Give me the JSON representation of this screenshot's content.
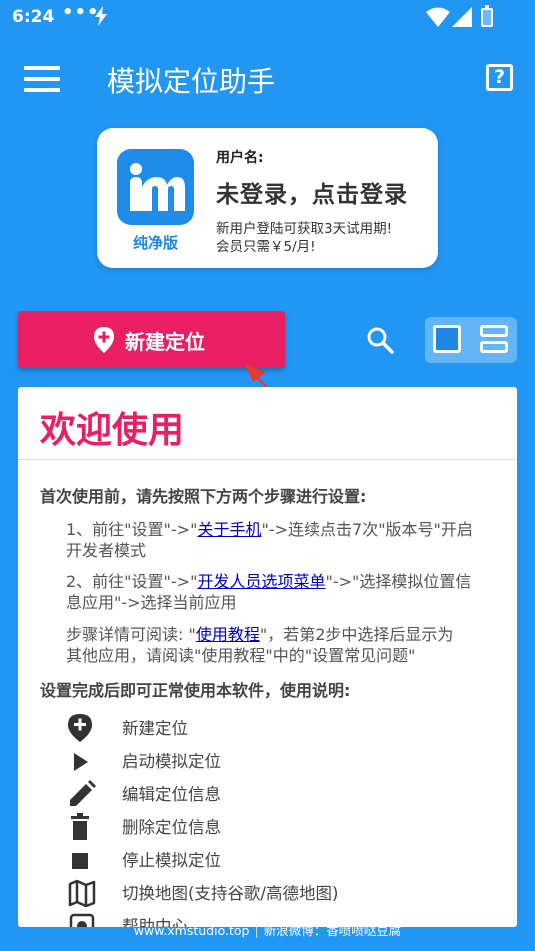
{
  "status_bar": {
    "time": "6:24",
    "dots": "•••"
  },
  "toolbar": {
    "title": "模拟定位助手",
    "help_label": "?"
  },
  "user_card": {
    "edition": "纯净版",
    "username_label": "用户名:",
    "login_text": "未登录，点击登录",
    "promo_line1": "新用户登陆可获取3天试用期!",
    "promo_line2": "会员只需￥5/月!"
  },
  "actions": {
    "new_location": "新建定位"
  },
  "welcome": {
    "title": "欢迎使用",
    "intro": "首次使用前，请先按照下方两个步骤进行设置:",
    "step1_a": "1、前往\"设置\"->\"",
    "step1_link": "关于手机",
    "step1_b": "\"->连续点击7次\"版本号\"开启",
    "step1_c": "开发者模式",
    "step2_a": "2、前往\"设置\"->\"",
    "step2_link": "开发人员选项菜单",
    "step2_b": "\"->\"选择模拟位置信",
    "step2_c": "息应用\"->选择当前应用",
    "step3_a": "步骤详情可阅读: \"",
    "step3_link": "使用教程",
    "step3_b": "\"，若第2步中选择后显示为",
    "step3_c": "其他应用，请阅读\"使用教程\"中的\"设置常见问题\"",
    "usage_title": "设置完成后即可正常使用本软件，使用说明:",
    "features": [
      {
        "icon": "add-location-icon",
        "label": "新建定位"
      },
      {
        "icon": "play-icon",
        "label": "启动模拟定位"
      },
      {
        "icon": "pencil-icon",
        "label": "编辑定位信息"
      },
      {
        "icon": "trash-icon",
        "label": "删除定位信息"
      },
      {
        "icon": "stop-icon",
        "label": "停止模拟定位"
      },
      {
        "icon": "map-icon",
        "label": "切换地图(支持谷歌/高德地图)"
      },
      {
        "icon": "help-center-icon",
        "label": "帮助中心"
      }
    ]
  },
  "footer": {
    "site": "www.xmstudio.top",
    "weibo": "新浪微博：香喷喷哒豆腐"
  },
  "colors": {
    "primary": "#2196f3",
    "accent": "#e91e63",
    "logo_blue": "#1e8ce8"
  }
}
